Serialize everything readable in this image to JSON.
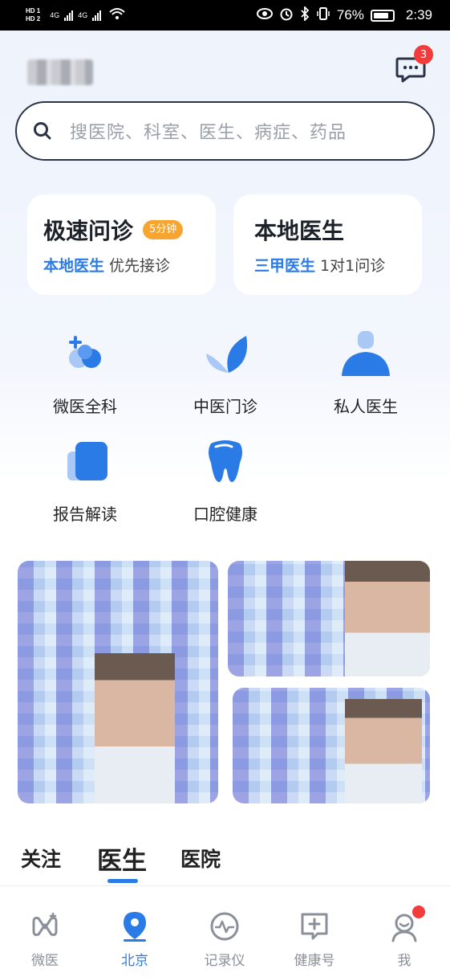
{
  "status_bar": {
    "hd1": "HD 1",
    "hd2": "HD 2",
    "net1": "4G",
    "net2": "4G",
    "battery": "76%",
    "time": "2:39"
  },
  "header": {
    "message_badge": "3"
  },
  "search": {
    "placeholder": "搜医院、科室、医生、病症、药品"
  },
  "cards": [
    {
      "title": "极速问诊",
      "tag": "5分钟",
      "sub_highlight": "本地医生",
      "sub_text": "优先接诊"
    },
    {
      "title": "本地医生",
      "sub_highlight": "三甲医生",
      "sub_text": "1对1问诊"
    }
  ],
  "services": [
    {
      "label": "微医全科",
      "icon": "plus-blob-icon"
    },
    {
      "label": "中医门诊",
      "icon": "leaf-icon"
    },
    {
      "label": "私人医生",
      "icon": "person-icon"
    },
    {
      "label": "报告解读",
      "icon": "report-icon"
    },
    {
      "label": "口腔健康",
      "icon": "tooth-icon"
    }
  ],
  "tabs": [
    {
      "label": "关注"
    },
    {
      "label": "医生",
      "active": true
    },
    {
      "label": "医院"
    }
  ],
  "bottom_nav": [
    {
      "label": "微医",
      "icon": "logo-icon"
    },
    {
      "label": "北京",
      "icon": "location-pin-icon",
      "active": true
    },
    {
      "label": "记录仪",
      "icon": "heartbeat-icon"
    },
    {
      "label": "健康号",
      "icon": "plus-chat-icon"
    },
    {
      "label": "我",
      "icon": "user-icon",
      "badge": true
    }
  ],
  "colors": {
    "accent": "#2b7be6",
    "badge": "#f23b3b",
    "tag": "#f7a531"
  }
}
